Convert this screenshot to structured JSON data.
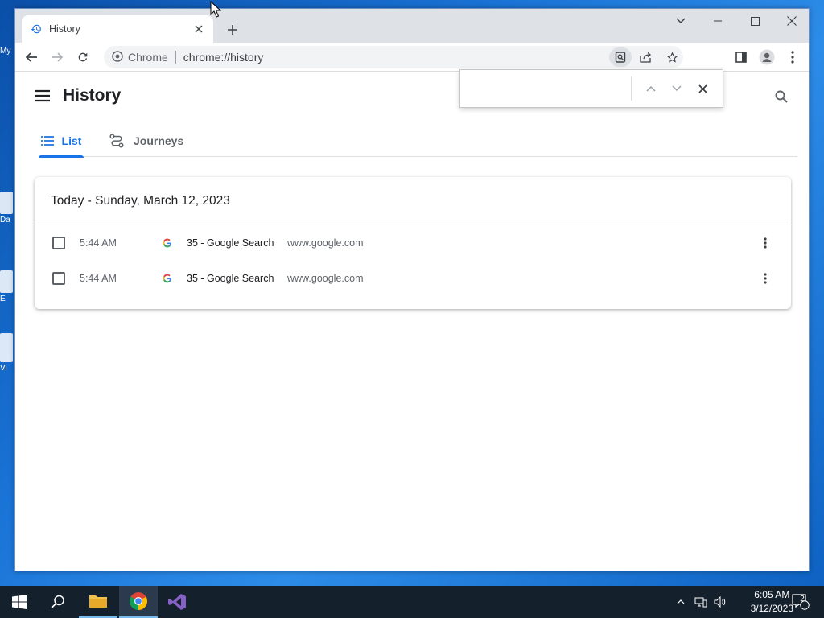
{
  "desktop": {
    "icons": [
      {
        "label": "My"
      },
      {
        "label": "Da"
      },
      {
        "label": "E"
      },
      {
        "label": "Vi"
      }
    ]
  },
  "browser": {
    "tab": {
      "title": "History"
    },
    "omnibox": {
      "site_label": "Chrome",
      "url": "chrome://history"
    }
  },
  "find_bar": {
    "value": "",
    "placeholder": ""
  },
  "history": {
    "title": "History",
    "tabs": [
      {
        "label": "List",
        "active": true
      },
      {
        "label": "Journeys",
        "active": false
      }
    ],
    "date_header": "Today - Sunday, March 12, 2023",
    "entries": [
      {
        "time": "5:44 AM",
        "title": "35 - Google Search",
        "domain": "www.google.com"
      },
      {
        "time": "5:44 AM",
        "title": "35 - Google Search",
        "domain": "www.google.com"
      }
    ]
  },
  "taskbar": {
    "apps": [
      {
        "name": "start-icon"
      },
      {
        "name": "search-icon"
      },
      {
        "name": "file-explorer-icon"
      },
      {
        "name": "chrome-icon"
      },
      {
        "name": "visual-studio-icon"
      }
    ],
    "clock": {
      "time": "6:05 AM",
      "date": "3/12/2023"
    },
    "notification_count": "2"
  },
  "colors": {
    "accent": "#1a73e8",
    "taskbar": "#15202d",
    "desktop": "#1a73d6"
  }
}
